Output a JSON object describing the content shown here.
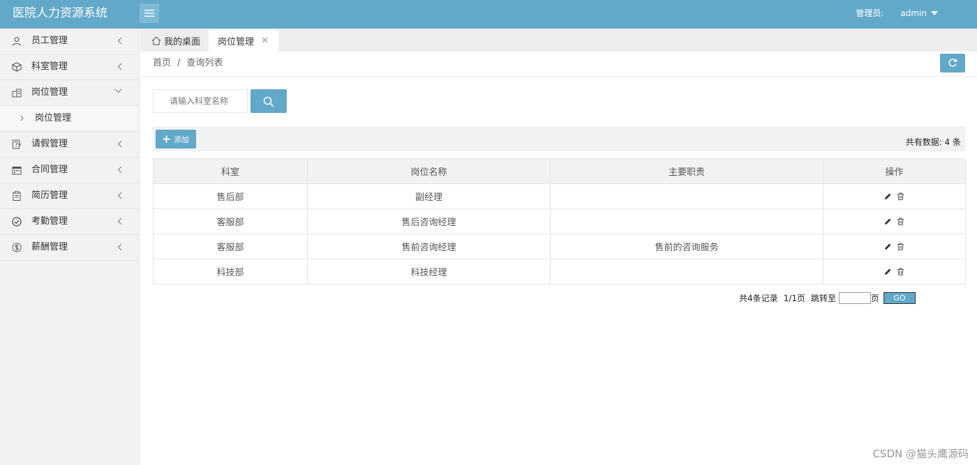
{
  "header": {
    "title": "医院人力资源系统",
    "role_label": "管理员:",
    "username": "admin"
  },
  "sidebar": {
    "items": [
      {
        "label": "员工管理",
        "icon": "user-icon"
      },
      {
        "label": "科室管理",
        "icon": "cube-icon"
      },
      {
        "label": "岗位管理",
        "icon": "building-icon",
        "expanded": true,
        "children": [
          {
            "label": "岗位管理"
          }
        ]
      },
      {
        "label": "请假管理",
        "icon": "leave-form-icon"
      },
      {
        "label": "合同管理",
        "icon": "calendar-icon"
      },
      {
        "label": "简历管理",
        "icon": "clipboard-icon"
      },
      {
        "label": "考勤管理",
        "icon": "check-circle-icon"
      },
      {
        "label": "薪酬管理",
        "icon": "dollar-circle-icon"
      }
    ]
  },
  "tabs": {
    "home_label": "我的桌面",
    "active_label": "岗位管理"
  },
  "breadcrumb": {
    "home": "首页",
    "separator": "/",
    "current": "查询列表"
  },
  "search": {
    "placeholder": "请输入科室名称",
    "value": ""
  },
  "toolbar": {
    "add_label": "添加",
    "total_label": "共有数据: 4 条"
  },
  "table": {
    "columns": [
      "科室",
      "岗位名称",
      "主要职责",
      "操作"
    ],
    "rows": [
      {
        "dept": "售后部",
        "position": "副经理",
        "duty": ""
      },
      {
        "dept": "客服部",
        "position": "售后咨询经理",
        "duty": ""
      },
      {
        "dept": "客服部",
        "position": "售前咨询经理",
        "duty": "售前的咨询服务"
      },
      {
        "dept": "科技部",
        "position": "科技经理",
        "duty": ""
      }
    ]
  },
  "pager": {
    "records": "共4条记录",
    "pages": "1/1页",
    "jump_label": "跳转至",
    "page_unit": "页",
    "go_label": "GO",
    "jump_value": ""
  },
  "watermark": "CSDN @猫头鹰源码",
  "colors": {
    "accent": "#62a8c9",
    "sidebar_bg": "#f2f2f2"
  }
}
